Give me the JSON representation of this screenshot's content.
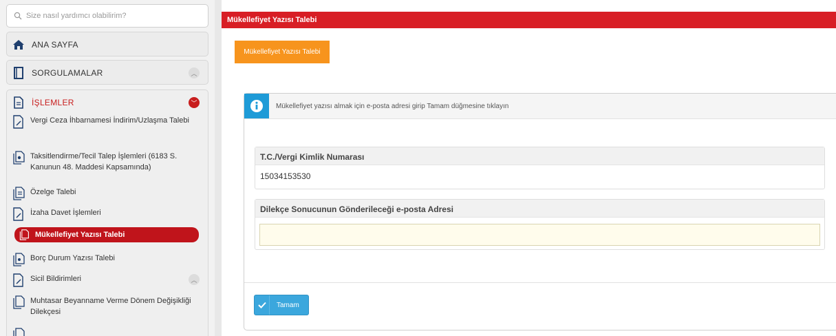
{
  "search": {
    "placeholder": "Size nasıl yardımcı olabilirim?"
  },
  "sidebar": {
    "home_label": "ANA SAYFA",
    "queries_label": "SORGULAMALAR",
    "operations_label": "İŞLEMLER",
    "items": [
      {
        "label": "Vergi Ceza İhbarnamesi İndirim/Uzlaşma Talebi"
      },
      {
        "label": "Taksitlendirme/Tecil Talep İşlemleri (6183 S. Kanunun 48. Maddesi Kapsamında)"
      },
      {
        "label": "Özelge Talebi"
      },
      {
        "label": "İzaha Davet İşlemleri"
      },
      {
        "label": "Mükellefiyet Yazısı Talebi"
      },
      {
        "label": "Borç Durum Yazısı Talebi"
      },
      {
        "label": "Sicil Bildirimleri"
      },
      {
        "label": "Muhtasar Beyanname Verme Dönem Değişikliği Dilekçesi"
      }
    ]
  },
  "main": {
    "header_title": "Mükellefiyet Yazısı Talebi",
    "tab_label": "Mükellefiyet Yazısı Talebi",
    "info_text": "Mükellefiyet yazısı almak için e-posta adresi girip Tamam düğmesine tıklayın",
    "tc_label": "T.C./Vergi Kimlik Numarası",
    "tc_value": "15034153530",
    "email_label": "Dilekçe Sonucunun Gönderileceği e-posta Adresi",
    "email_value": "",
    "submit_label": "Tamam"
  },
  "colors": {
    "accent_red": "#d81e25",
    "tab_orange": "#f7941d",
    "info_blue": "#1e9bd7",
    "button_blue": "#3ba7dd"
  }
}
